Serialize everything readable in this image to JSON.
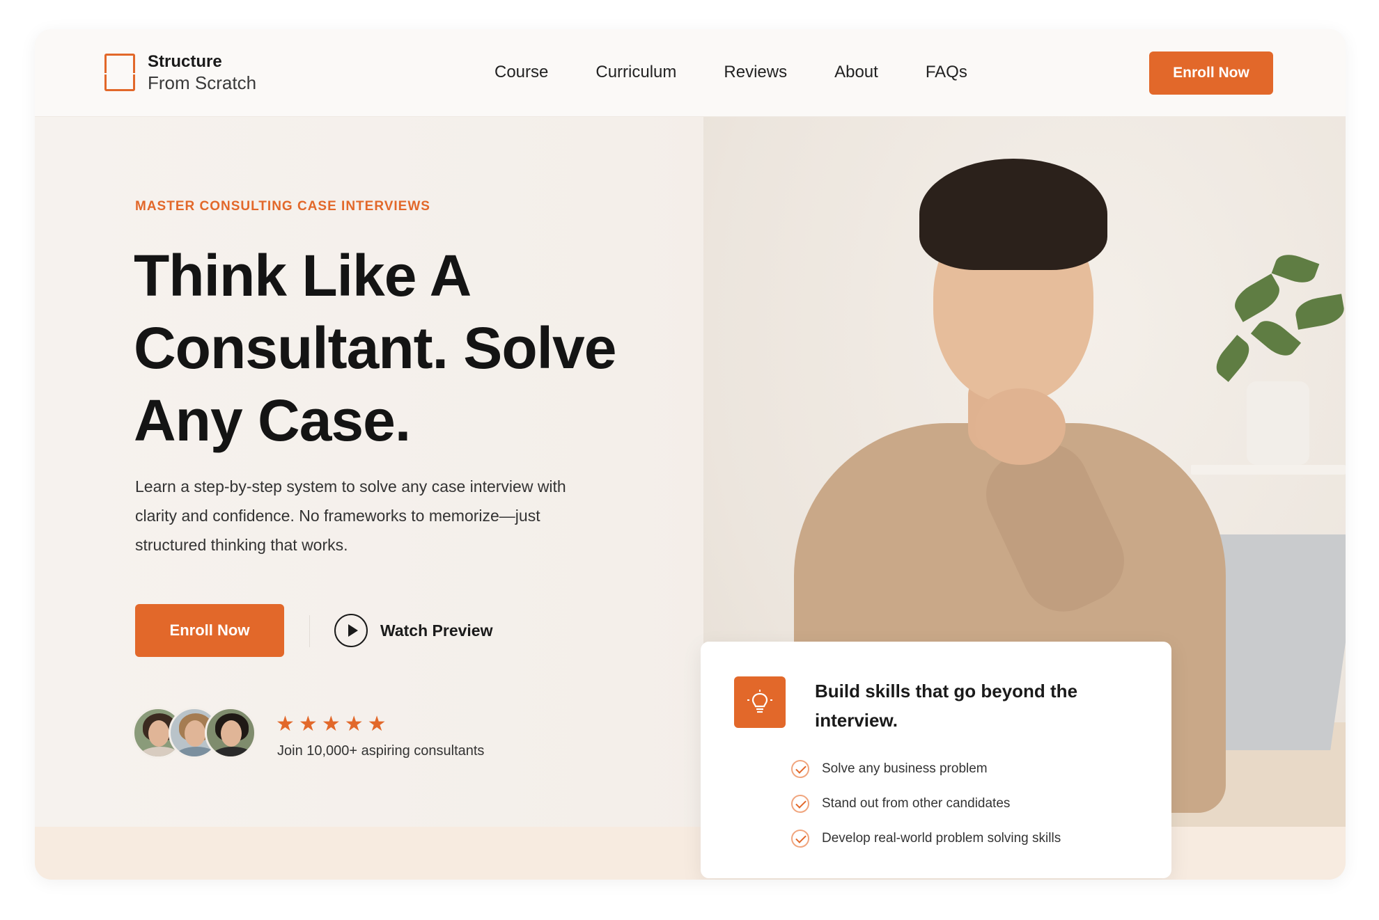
{
  "brand": {
    "line1": "Structure",
    "line2": "From Scratch",
    "accent": "#e2682a"
  },
  "nav": {
    "items": [
      "Course",
      "Curriculum",
      "Reviews",
      "About",
      "FAQs"
    ]
  },
  "header": {
    "cta_label": "Enroll Now"
  },
  "hero": {
    "eyebrow": "MASTER CONSULTING CASE INTERVIEWS",
    "headline": "Think Like A Consultant. Solve Any Case.",
    "subtext": "Learn a step-by-step system to solve any case interview with clarity and confidence. No frameworks to memorize—just structured thinking that works.",
    "primary_cta": "Enroll Now",
    "secondary_cta": "Watch Preview",
    "rating_stars": 5,
    "social_proof": "Join 10,000+ aspiring consultants"
  },
  "card": {
    "icon": "lightbulb-icon",
    "title": "Build skills that go beyond the interview.",
    "items": [
      "Solve any business problem",
      "Stand out from other candidates",
      "Develop real-world problem solving skills"
    ]
  }
}
